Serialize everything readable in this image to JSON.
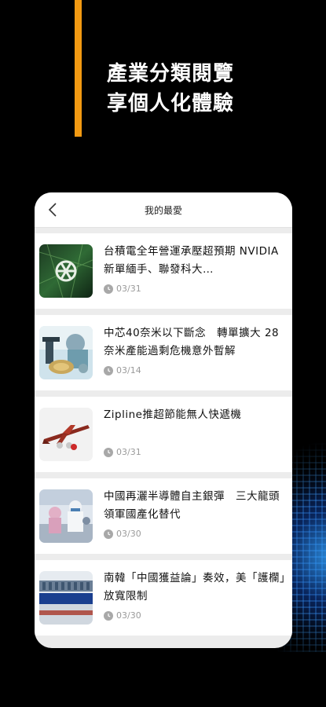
{
  "promo": {
    "line1": "產業分類閱覽",
    "line2": "享個人化體驗"
  },
  "phone": {
    "title": "我的最愛",
    "back_icon": "chevron-left-icon",
    "articles": [
      {
        "title": "台積電全年營運承壓超預期 NVIDIA新單緬手、聯發科大…",
        "date": "03/31",
        "thumb_icon": "chip-logo-thumbnail"
      },
      {
        "title": "中芯40奈米以下斷念　轉單擴大 28奈米產能過剩危機意外暫解",
        "date": "03/14",
        "thumb_icon": "lab-microscope-thumbnail"
      },
      {
        "title": "Zipline推超節能無人快遞機",
        "date": "03/31",
        "thumb_icon": "drone-thumbnail"
      },
      {
        "title": "中國再灑半導體自主銀彈　三大龍頭領軍國產化替代",
        "date": "03/30",
        "thumb_icon": "cleanroom-workers-thumbnail"
      },
      {
        "title": "南韓「中國獲益論」奏效，美「護欄」放寬限制",
        "date": "03/30",
        "thumb_icon": "samsung-building-thumbnail"
      }
    ]
  },
  "colors": {
    "accent": "#f39a12",
    "background": "#000000",
    "card": "#ffffff",
    "meta": "#9a9a9a"
  }
}
